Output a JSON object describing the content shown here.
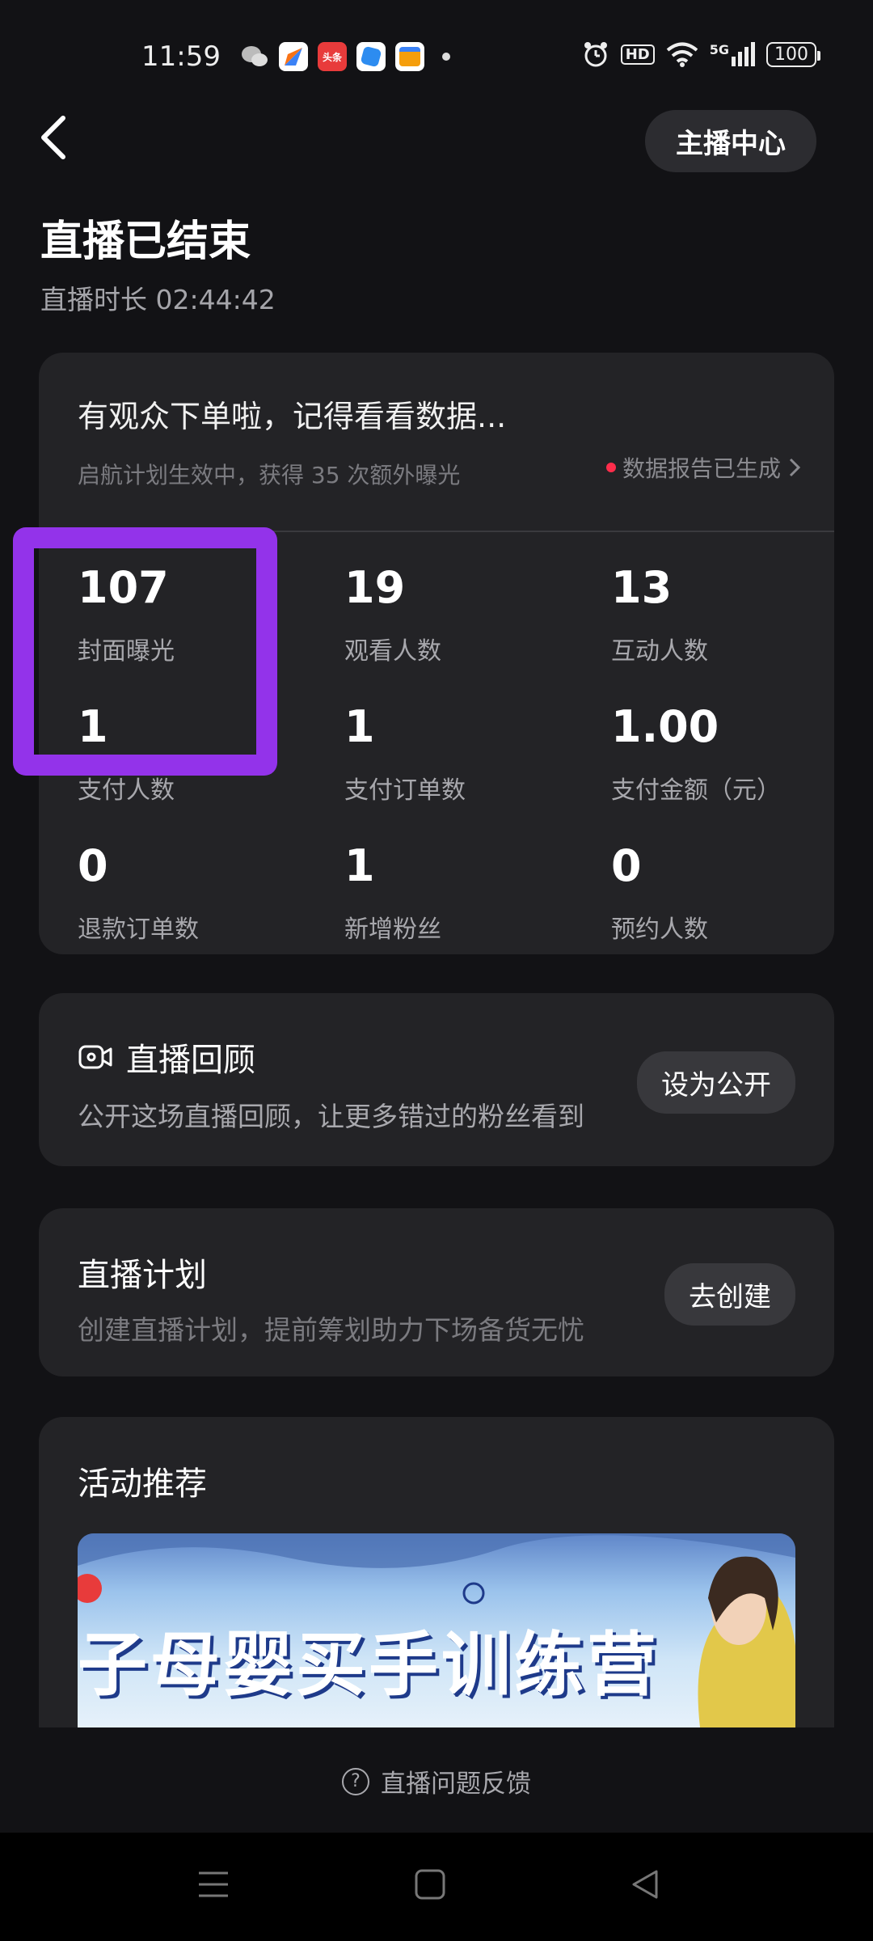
{
  "status_bar": {
    "time": "11:59",
    "apps": [
      {
        "name": "wechat-icon",
        "label": "",
        "color": "#6b6b6b"
      },
      {
        "name": "app-icon-1",
        "label": "",
        "color": "#3b82f6"
      },
      {
        "name": "toutiao-icon",
        "label": "头条",
        "color": "#e83b3b"
      },
      {
        "name": "app-icon-3",
        "label": "",
        "color": "#2d8cf0"
      },
      {
        "name": "wallet-icon",
        "label": "",
        "color": "#f5f5f5"
      }
    ],
    "hd": "HD",
    "signal": "5G",
    "battery": "100"
  },
  "header": {
    "anchor_center": "主播中心",
    "title": "直播已结束",
    "duration": "直播时长 02:44:42"
  },
  "stats": {
    "notice_title": "有观众下单啦，记得看看数据...",
    "notice_sub": "启航计划生效中，获得 35 次额外曝光",
    "report_link": "数据报告已生成",
    "metrics": [
      {
        "value": "107",
        "label": "封面曝光"
      },
      {
        "value": "19",
        "label": "观看人数"
      },
      {
        "value": "13",
        "label": "互动人数"
      },
      {
        "value": "1",
        "label": "支付人数"
      },
      {
        "value": "1",
        "label": "支付订单数"
      },
      {
        "value": "1.00",
        "label": "支付金额（元）"
      },
      {
        "value": "0",
        "label": "退款订单数"
      },
      {
        "value": "1",
        "label": "新增粉丝"
      },
      {
        "value": "0",
        "label": "预约人数"
      }
    ],
    "accent_color": "#9333ea"
  },
  "replay": {
    "title": "直播回顾",
    "desc": "公开这场直播回顾，让更多错过的粉丝看到",
    "button": "设为公开"
  },
  "plan": {
    "title": "直播计划",
    "desc": "创建直播计划，提前筹划助力下场备货无忧",
    "button": "去创建"
  },
  "events": {
    "title": "活动推荐",
    "banner_text": "子母婴买手训练营"
  },
  "feedback": "直播问题反馈",
  "nav": [
    "menu-icon",
    "home-icon",
    "back-nav-icon"
  ]
}
